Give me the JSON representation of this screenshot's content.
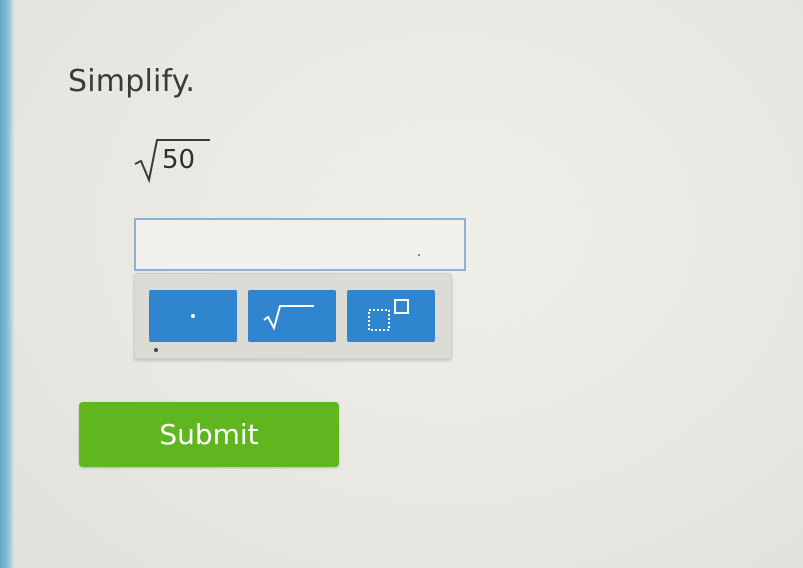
{
  "question": {
    "prompt": "Simplify.",
    "radicand": "50"
  },
  "answer": {
    "value": ""
  },
  "keypad": {
    "keys": [
      {
        "name": "decimal-point",
        "icon": "dot-icon"
      },
      {
        "name": "square-root",
        "icon": "sqrt-icon"
      },
      {
        "name": "exponent",
        "icon": "exponent-box-icon"
      }
    ]
  },
  "actions": {
    "submit_label": "Submit"
  },
  "colors": {
    "key_blue": "#2f86cf",
    "submit_green": "#5fb61e",
    "input_border": "#8fb0cf"
  }
}
